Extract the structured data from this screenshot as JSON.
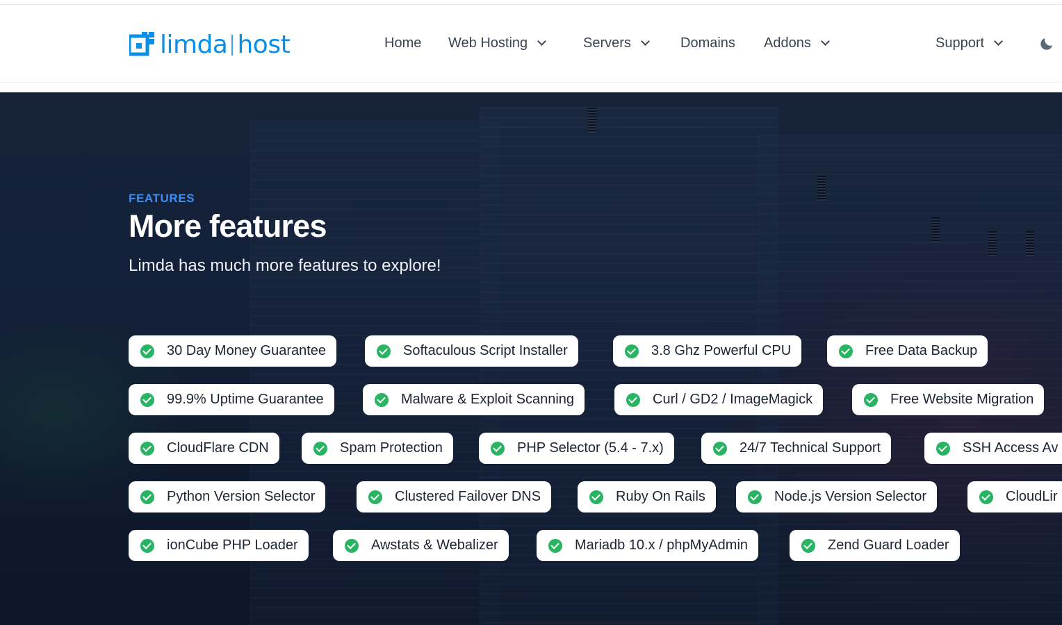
{
  "brand": {
    "part1": "limda",
    "part2": "host",
    "color": "#0a8fe6"
  },
  "nav": {
    "items": [
      {
        "label": "Home",
        "dropdown": false
      },
      {
        "label": "Web Hosting",
        "dropdown": true
      },
      {
        "label": "Servers",
        "dropdown": true
      },
      {
        "label": "Domains",
        "dropdown": false
      },
      {
        "label": "Addons",
        "dropdown": true
      },
      {
        "label": "Support",
        "dropdown": true
      }
    ],
    "theme_toggle_icon": "moon-icon"
  },
  "features": {
    "eyebrow": "FEATURES",
    "title": "More features",
    "subtitle": "Limda has much more features to explore!",
    "check_icon": "check-circle-icon",
    "check_color": "#28b463",
    "eyebrow_color": "#3c8ff5",
    "items": [
      "30 Day Money Guarantee",
      "Softaculous Script Installer",
      "3.8 Ghz Powerful CPU",
      "Free Data Backup",
      "99.9% Uptime Guarantee",
      "Malware & Exploit Scanning",
      "Curl / GD2 / ImageMagick",
      "Free Website Migration",
      "CloudFlare CDN",
      "Spam Protection",
      "PHP Selector (5.4 - 7.x)",
      "24/7 Technical Support",
      "SSH Access Av",
      "Python Version Selector",
      "Clustered Failover DNS",
      "Ruby On Rails",
      "Node.js Version Selector",
      "CloudLir",
      "ionCube PHP Loader",
      "Awstats & Webalizer",
      "Mariadb 10.x / phpMyAdmin",
      "Zend Guard Loader"
    ]
  }
}
